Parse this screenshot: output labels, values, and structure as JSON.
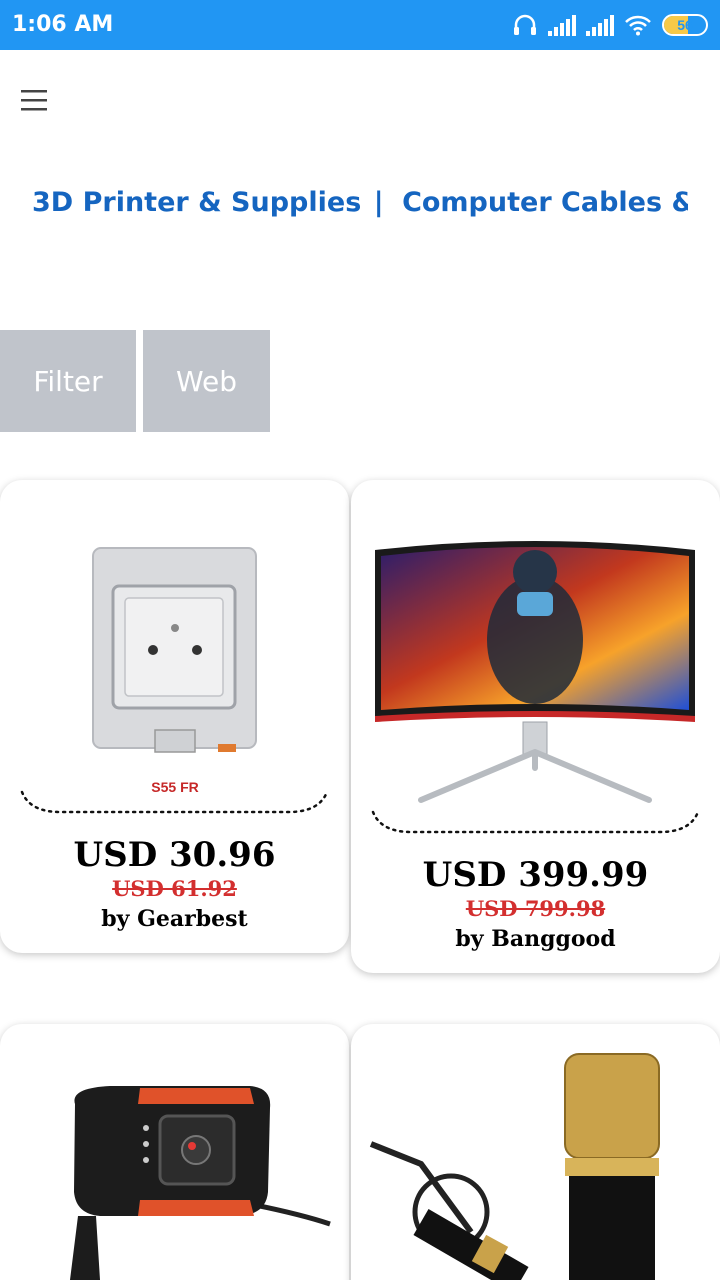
{
  "status_bar": {
    "time": "1:06 AM",
    "battery": "56",
    "battery_level": 0.56,
    "icons": [
      "headphones-icon",
      "signal-icon",
      "signal-icon",
      "wifi-icon",
      "battery-icon"
    ]
  },
  "header": {
    "menu_icon": "hamburger-menu-icon"
  },
  "categories": [
    "3D Printer & Supplies",
    "Computer Cables & Co"
  ],
  "categories_separator": "|",
  "buttons": {
    "filter": "Filter",
    "web": "Web"
  },
  "products": [
    {
      "image": "weatherproof-socket-image",
      "image_label": "S55 FR",
      "price": "USD 30.96",
      "old_price": "USD 61.92",
      "seller": "by Gearbest"
    },
    {
      "image": "curved-monitor-image",
      "price": "USD 399.99",
      "old_price": "USD 799.98",
      "seller": "by Banggood"
    },
    {
      "image": "webcam-image"
    },
    {
      "image": "microphone-image"
    }
  ]
}
